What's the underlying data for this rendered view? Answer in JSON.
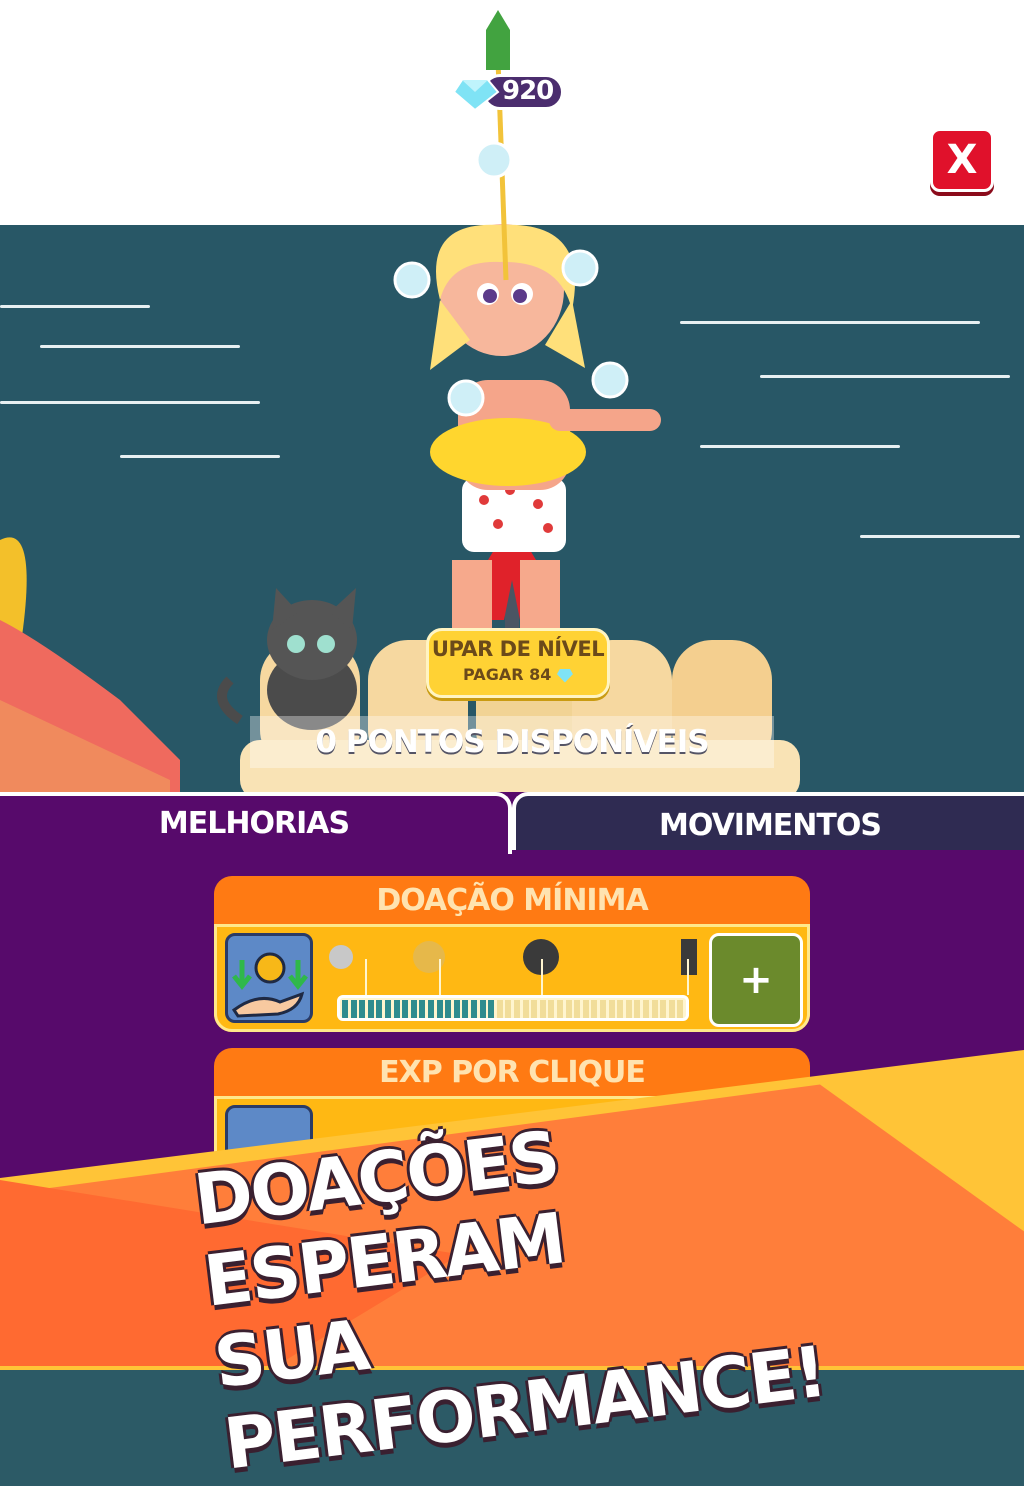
{
  "hud": {
    "gems": "920",
    "close_label": "X"
  },
  "level_up": {
    "title": "UPAR DE NÍVEL",
    "cost_label": "PAGAR 84"
  },
  "points_label": "0 PONTOS DISPONÍVEIS",
  "tabs": [
    {
      "label": "MELHORIAS",
      "active": true
    },
    {
      "label": "MOVIMENTOS",
      "active": false
    }
  ],
  "upgrades": [
    {
      "title": "DOAÇÃO MÍNIMA",
      "progress_fraction": 0.45,
      "button": "+",
      "icon": "donation-hand-icon"
    },
    {
      "title": "EXP POR CLIQUE",
      "icon": "exp-icon"
    }
  ],
  "promo": {
    "line1": "DOAÇÕES ESPERAM",
    "line2": "SUA PERFORMANCE!"
  },
  "colors": {
    "panel": "#570a6b",
    "tab_inactive": "#2f2b52",
    "card_orange": "#ff7a13",
    "card_yellow": "#ffb813",
    "close_red": "#e0112b",
    "progress_teal": "#2f8c8e",
    "sea": "#285766"
  }
}
